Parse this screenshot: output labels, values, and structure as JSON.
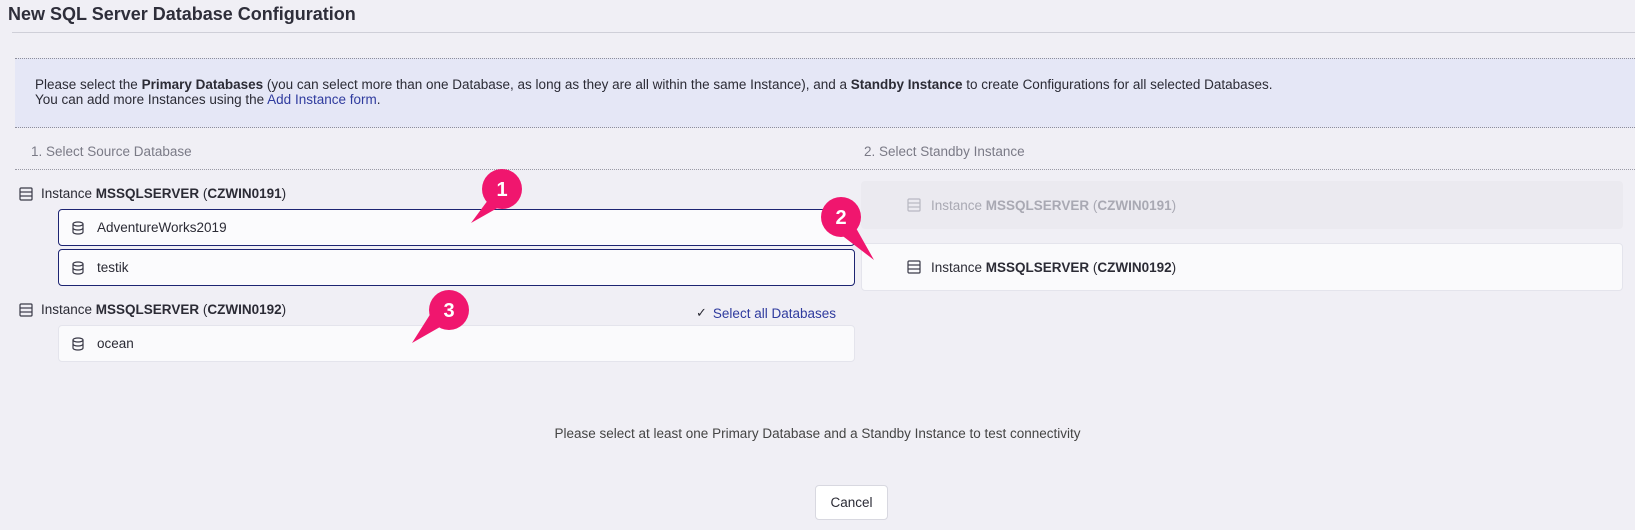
{
  "title": "New SQL Server Database Configuration",
  "info": {
    "line1_pre": "Please select the ",
    "line1_bold1": "Primary Databases",
    "line1_mid": " (you can select more than one Database, as long as they are all within the same Instance), and a ",
    "line1_bold2": "Standby Instance",
    "line1_post": " to create Configurations for all selected Databases.",
    "line2_pre": "You can add more Instances using the ",
    "line2_link": "Add Instance form",
    "line2_post": "."
  },
  "source": {
    "heading": "1. Select Source Database",
    "instances": [
      {
        "prefix": "Instance ",
        "name": "MSSQLSERVER",
        "host_open": " (",
        "host": "CZWIN0191",
        "host_close": ")",
        "databases": [
          {
            "name": "AdventureWorks2019",
            "selected": true
          },
          {
            "name": "testik",
            "selected": true
          }
        ]
      },
      {
        "prefix": "Instance ",
        "name": "MSSQLSERVER",
        "host_open": " (",
        "host": "CZWIN0192",
        "host_close": ")",
        "select_all_label": "Select all Databases",
        "databases": [
          {
            "name": "ocean",
            "selected": false
          }
        ]
      }
    ]
  },
  "standby": {
    "heading": "2. Select Standby Instance",
    "instances": [
      {
        "prefix": "Instance ",
        "name": "MSSQLSERVER",
        "host_open": " (",
        "host": "CZWIN0191",
        "host_close": ")",
        "state": "disabled"
      },
      {
        "prefix": "Instance ",
        "name": "MSSQLSERVER",
        "host_open": " (",
        "host": "CZWIN0192",
        "host_close": ")",
        "state": "enabled"
      }
    ]
  },
  "hint": "Please select at least one Primary Database and a Standby Instance to test connectivity",
  "cancel_label": "Cancel",
  "callouts": [
    "1",
    "2",
    "3"
  ],
  "colors": {
    "callout": "#f0166e",
    "selected_border": "#1d2472",
    "link": "#2f3b9e",
    "info_bg": "#e5e7f6"
  },
  "icons": {
    "instance": "server-icon",
    "database": "database-icon",
    "check": "check-icon"
  }
}
